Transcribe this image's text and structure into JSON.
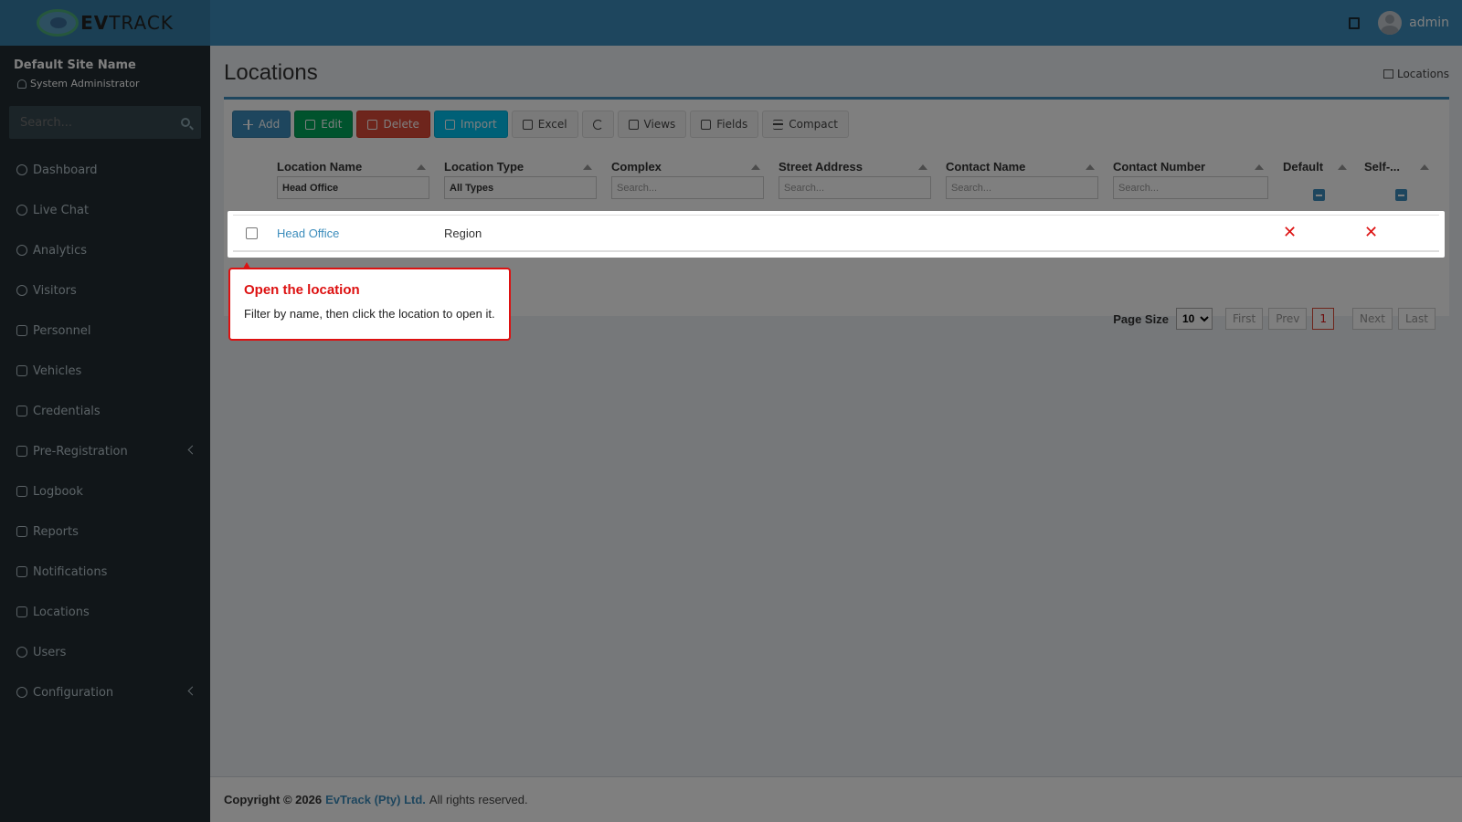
{
  "app": {
    "logo_text_bold": "EV",
    "logo_text_rest": "TRACK",
    "user": "admin"
  },
  "sidebar": {
    "site_name": "Default Site Name",
    "role": "System Administrator",
    "search_placeholder": "Search...",
    "items": [
      {
        "label": "Dashboard",
        "icon": "dashboard-icon"
      },
      {
        "label": "Live Chat",
        "icon": "headset-icon"
      },
      {
        "label": "Analytics",
        "icon": "target-icon"
      },
      {
        "label": "Visitors",
        "icon": "eye-icon"
      },
      {
        "label": "Personnel",
        "icon": "user-tag-icon"
      },
      {
        "label": "Vehicles",
        "icon": "car-icon"
      },
      {
        "label": "Credentials",
        "icon": "id-card-icon"
      },
      {
        "label": "Pre-Registration",
        "icon": "exchange-icon"
      },
      {
        "label": "Logbook",
        "icon": "book-icon"
      },
      {
        "label": "Reports",
        "icon": "chart-icon"
      },
      {
        "label": "Notifications",
        "icon": "comments-icon"
      },
      {
        "label": "Locations",
        "icon": "map-icon"
      },
      {
        "label": "Users",
        "icon": "users-icon"
      },
      {
        "label": "Configuration",
        "icon": "gear-icon"
      }
    ]
  },
  "page": {
    "title": "Locations",
    "breadcrumb": "Locations"
  },
  "toolbar": {
    "add": "Add",
    "edit": "Edit",
    "delete": "Delete",
    "import": "Import",
    "excel": "Excel",
    "views": "Views",
    "fields": "Fields",
    "compact": "Compact"
  },
  "table": {
    "columns": [
      "Location Name",
      "Location Type",
      "Complex",
      "Street Address",
      "Contact Name",
      "Contact Number",
      "Default",
      "Self-..."
    ],
    "filters": {
      "location_name": "Head Office",
      "location_type": "All Types",
      "placeholder": "Search..."
    },
    "rows": [
      {
        "location_name": "Head Office",
        "location_type": "Region",
        "default": "✕",
        "self": "✕"
      }
    ]
  },
  "pager": {
    "label": "Page Size",
    "size": "10",
    "first": "First",
    "prev": "Prev",
    "current": "1",
    "next": "Next",
    "last": "Last"
  },
  "footer": {
    "copyright": "Copyright © 2026",
    "company": "EvTrack (Pty) Ltd.",
    "rights": "All rights reserved."
  },
  "tooltip": {
    "title": "Open the location",
    "body": "Filter by name, then click the location to open it."
  },
  "colors": {
    "primary": "#3c8dbc",
    "sidebar": "#222d32",
    "accent_red": "#dd1111"
  }
}
